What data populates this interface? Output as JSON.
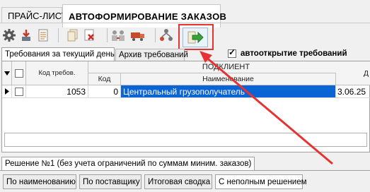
{
  "top_tabs": [
    "ПРАЙС-ЛИСТ",
    "АВТОФОРМИРОВАНИЕ ЗАКАЗОВ"
  ],
  "toolbar": {
    "icons": [
      "gear-icon",
      "download-icon",
      "document-icon",
      "copy-icon",
      "delete-icon",
      "people-icon",
      "truck-icon",
      "network-icon",
      "export-arrow-icon"
    ],
    "highlight_color": "#e53333"
  },
  "sub_tabs": [
    "Требования за текущий день",
    "Архив требований"
  ],
  "autoopen": {
    "label": "автооткрытие требований",
    "checked": true
  },
  "grid": {
    "group_header": "ПОДКЛИЕНТ",
    "columns": [
      "Код требов.",
      "Код",
      "Наименование",
      "Д"
    ],
    "rows": [
      {
        "req_code": "1053",
        "code": "0",
        "name": "Центральный грузополучатель",
        "date": "3.06.25"
      }
    ]
  },
  "solution_tab": "Решение №1 (без учета ограничений по суммам миним. заказов)",
  "bottom_buttons": [
    "По наименованию",
    "По поставщику",
    "Итоговая сводка",
    "С неполным решением"
  ]
}
